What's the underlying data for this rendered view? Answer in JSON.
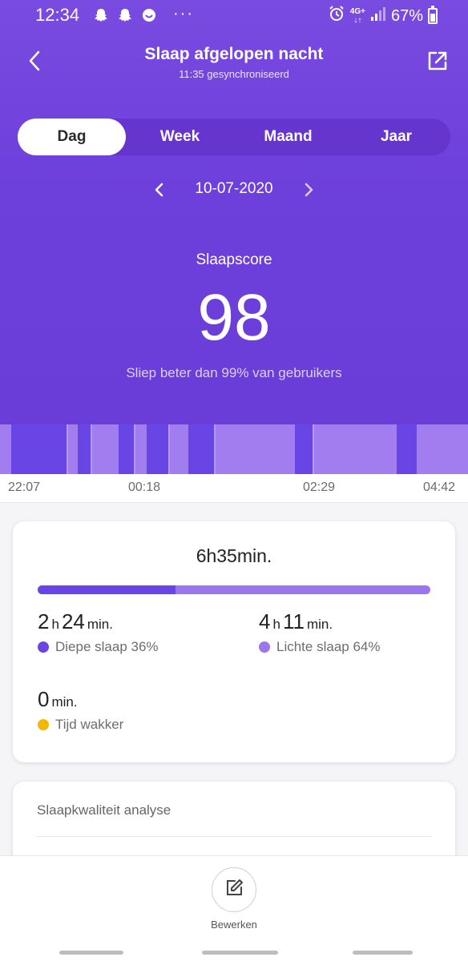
{
  "statusbar": {
    "time": "12:34",
    "dots": "···",
    "network_top": "4G+",
    "network_bottom": "↓↑",
    "battery": "67%"
  },
  "header": {
    "title": "Slaap afgelopen nacht",
    "subtitle": "11:35 gesynchroniseerd",
    "tabs": [
      {
        "label": "Dag",
        "active": true
      },
      {
        "label": "Week",
        "active": false
      },
      {
        "label": "Maand",
        "active": false
      },
      {
        "label": "Jaar",
        "active": false
      }
    ],
    "date": "10-07-2020"
  },
  "score": {
    "label": "Slaapscore",
    "value": "98",
    "description": "Sliep beter dan 99% van gebruikers"
  },
  "timeline": {
    "ticks": [
      "22:07",
      "00:18",
      "02:29",
      "04:42"
    ],
    "deep_segments_fraction": [
      [
        0.024,
        0.142
      ],
      [
        0.166,
        0.194
      ],
      [
        0.254,
        0.286
      ],
      [
        0.313,
        0.36
      ],
      [
        0.403,
        0.457
      ],
      [
        0.63,
        0.668
      ],
      [
        0.848,
        0.89
      ]
    ]
  },
  "summary": {
    "total": "6h35min.",
    "deep_fraction": 0.35,
    "deep": {
      "hours": "2",
      "h_unit": "h",
      "minutes": "24",
      "min_unit": "min.",
      "label": "Diepe slaap 36%",
      "color": "#6a45e6"
    },
    "light": {
      "hours": "4",
      "h_unit": "h",
      "minutes": "11",
      "min_unit": "min.",
      "label": "Lichte slaap 64%",
      "color": "#9c76ec"
    },
    "awake": {
      "minutes": "0",
      "min_unit": "min.",
      "label": "Tijd wakker",
      "color": "#f5b800"
    }
  },
  "analysis": {
    "title": "Slaapkwaliteit analyse"
  },
  "bottom": {
    "edit_label": "Bewerken"
  },
  "icons": {
    "back": "back-arrow-icon",
    "share": "share-icon",
    "prev": "chevron-left-icon",
    "next": "chevron-right-icon",
    "edit": "edit-icon"
  }
}
